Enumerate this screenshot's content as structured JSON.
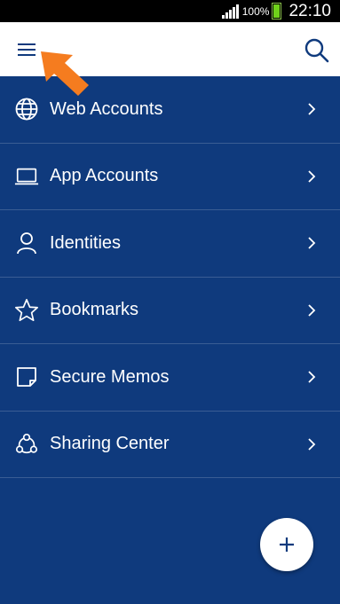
{
  "status_bar": {
    "battery_text": "100%",
    "time": "22:10"
  },
  "app_bar": {
    "menu_icon": "hamburger-menu-icon",
    "search_icon": "search-icon"
  },
  "nav_items": [
    {
      "label": "Web Accounts",
      "icon": "globe-icon"
    },
    {
      "label": "App Accounts",
      "icon": "laptop-icon"
    },
    {
      "label": "Identities",
      "icon": "person-icon"
    },
    {
      "label": "Bookmarks",
      "icon": "star-icon"
    },
    {
      "label": "Secure Memos",
      "icon": "note-icon"
    },
    {
      "label": "Sharing Center",
      "icon": "share-icon"
    }
  ],
  "fab": {
    "label": "+"
  },
  "colors": {
    "primary": "#0f3a7d",
    "accent_arrow": "#f57c1f",
    "battery": "#6fd21a"
  }
}
